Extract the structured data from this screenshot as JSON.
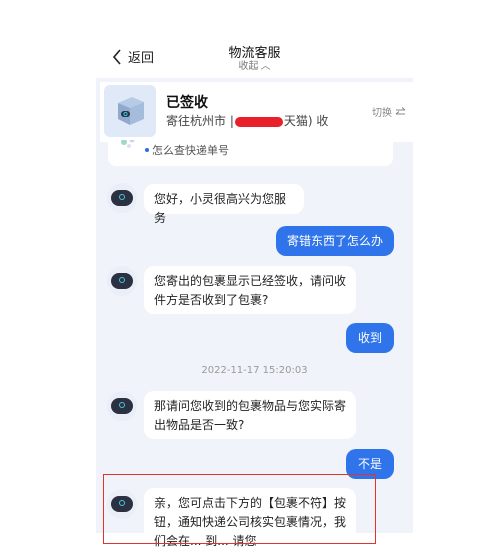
{
  "header": {
    "back_label": "返回",
    "title": "物流客服",
    "collapse_label": "收起"
  },
  "package": {
    "status": "已签收",
    "route_prefix": "寄往杭州市 |",
    "route_suffix": "天猫) 收",
    "switch_label": "切换"
  },
  "quick_question": {
    "text": "怎么查快递单号"
  },
  "messages": {
    "m1": "您好，小灵很高兴为您服务",
    "m2": "寄错东西了怎么办",
    "m3_line1": "您寄出的包裹显示已经签收，请问收",
    "m3_line2": "件方是否收到了包裹?",
    "m4": "收到",
    "timestamp": "2022-11-17 15:20:03",
    "m5_line1": "那请问您收到的包裹物品与您实际寄",
    "m5_line2": "出物品是否一致?",
    "m6": "不是",
    "m7_line1": "亲，您可点击下方的【包裹不符】按",
    "m7_line2": "钮，通知快递公司核实包裹情况，我",
    "m7_line3": "们会在... 到... 请您"
  },
  "colors": {
    "accent": "#2f74ea",
    "background": "#f0f3f9",
    "highlight": "#e0342d",
    "redaction": "#e8202a"
  }
}
